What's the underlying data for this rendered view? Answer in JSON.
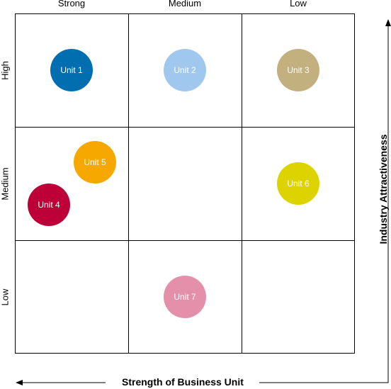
{
  "columns": [
    {
      "label": "Strong"
    },
    {
      "label": "Medium"
    },
    {
      "label": "Low"
    }
  ],
  "rows": [
    {
      "label": "High"
    },
    {
      "label": "Medium"
    },
    {
      "label": "Low"
    }
  ],
  "x_axis": {
    "title": "Strength of Business Unit",
    "direction": "left"
  },
  "y_axis": {
    "title": "Industry Attractiveness",
    "direction": "up"
  },
  "units": [
    {
      "label": "Unit 1",
      "strength": "Strong",
      "attractiveness": "High",
      "color": "#006EAF"
    },
    {
      "label": "Unit 2",
      "strength": "Medium",
      "attractiveness": "High",
      "color": "#A0C8EF"
    },
    {
      "label": "Unit 3",
      "strength": "Low",
      "attractiveness": "High",
      "color": "#C2B07E"
    },
    {
      "label": "Unit 4",
      "strength": "Strong",
      "attractiveness": "Medium",
      "color": "#BE0039"
    },
    {
      "label": "Unit 5",
      "strength": "Strong",
      "attractiveness": "Medium",
      "color": "#F6A800"
    },
    {
      "label": "Unit 6",
      "strength": "Low",
      "attractiveness": "Medium",
      "color": "#DCD300"
    },
    {
      "label": "Unit 7",
      "strength": "Medium",
      "attractiveness": "Low",
      "color": "#E490AB"
    }
  ]
}
